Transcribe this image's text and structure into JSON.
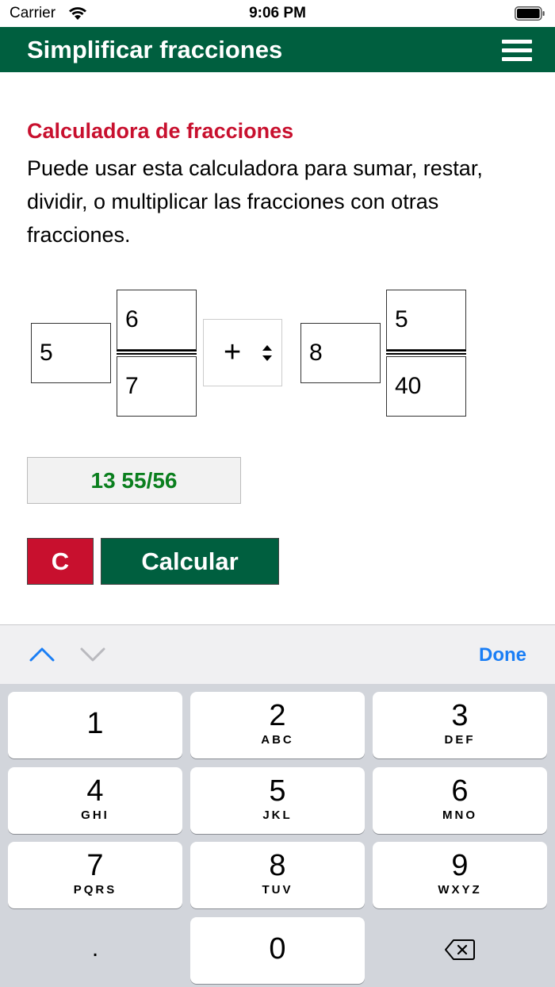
{
  "status_bar": {
    "carrier": "Carrier",
    "time": "9:06 PM"
  },
  "header": {
    "title": "Simplificar fracciones",
    "menu_icon": "hamburger-menu-icon"
  },
  "section": {
    "title": "Calculadora de fracciones",
    "description": "Puede usar esta calculadora para sumar, restar, dividir, o multiplicar las fracciones con otras fracciones."
  },
  "calculator": {
    "first": {
      "whole": "5",
      "numerator": "6",
      "denominator": "7"
    },
    "operator": "+",
    "second": {
      "whole": "8",
      "numerator": "5",
      "denominator": "40"
    },
    "result": "13 55/56",
    "clear_label": "C",
    "calculate_label": "Calcular"
  },
  "keyboard_toolbar": {
    "done_label": "Done"
  },
  "keypad": {
    "keys": [
      {
        "num": "1",
        "letters": ""
      },
      {
        "num": "2",
        "letters": "ABC"
      },
      {
        "num": "3",
        "letters": "DEF"
      },
      {
        "num": "4",
        "letters": "GHI"
      },
      {
        "num": "5",
        "letters": "JKL"
      },
      {
        "num": "6",
        "letters": "MNO"
      },
      {
        "num": "7",
        "letters": "PQRS"
      },
      {
        "num": "8",
        "letters": "TUV"
      },
      {
        "num": "9",
        "letters": "WXYZ"
      }
    ],
    "decimal": ".",
    "zero": "0"
  },
  "colors": {
    "header_bg": "#005f3f",
    "title_red": "#c8102e",
    "result_green": "#0a7f1e",
    "link_blue": "#1a7ef5"
  }
}
